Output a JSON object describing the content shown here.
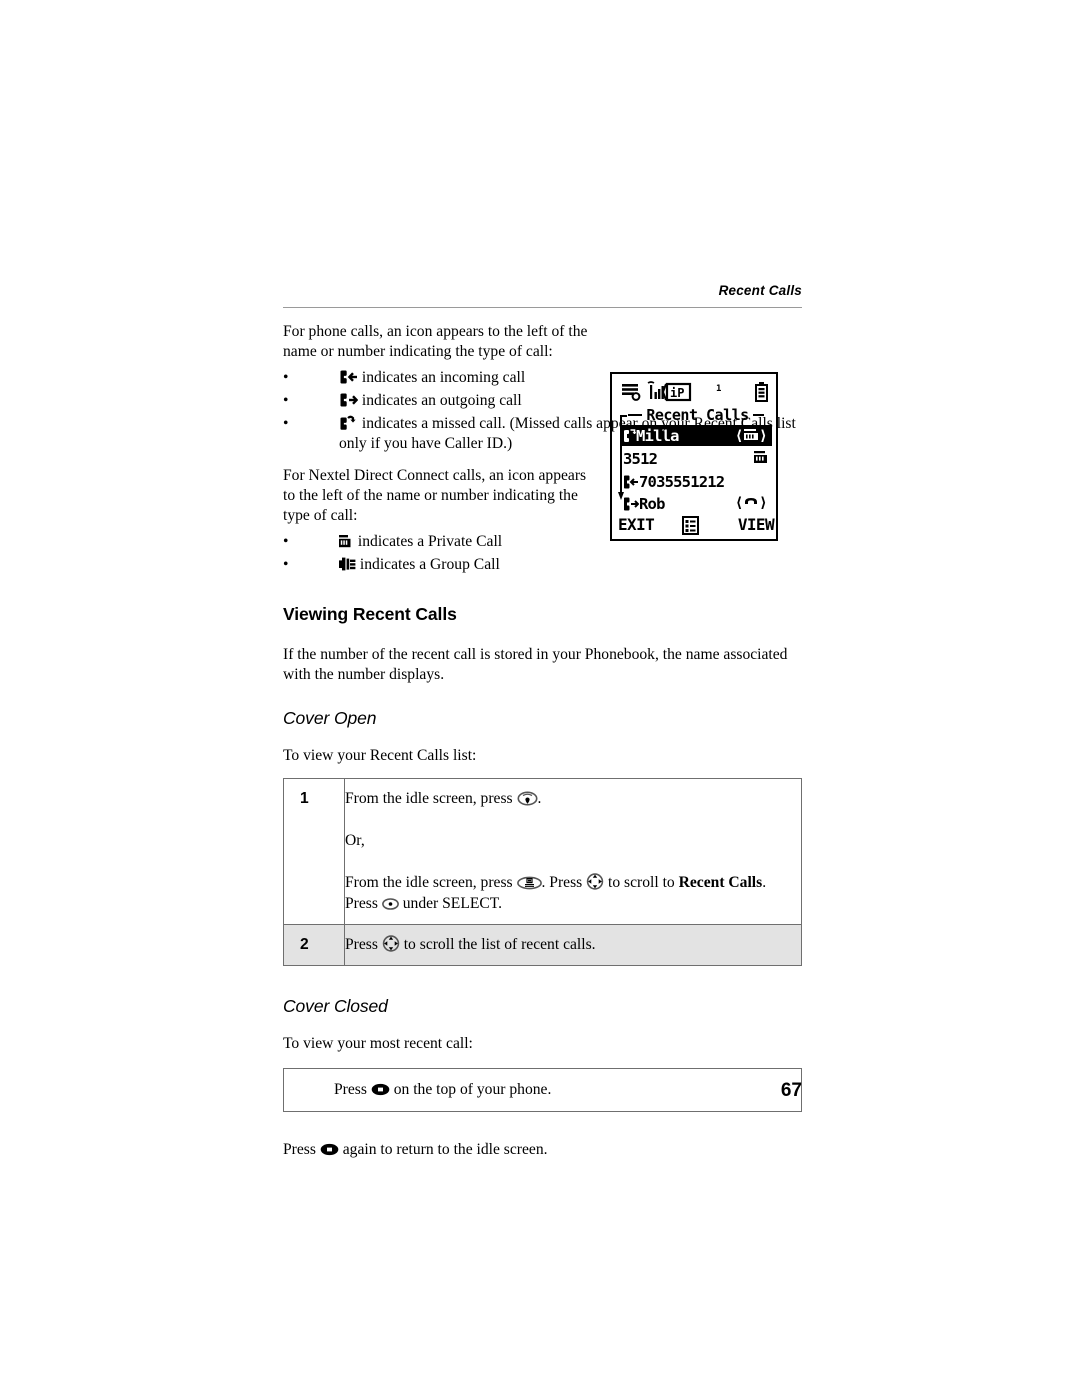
{
  "header": {
    "title": "Recent Calls"
  },
  "intro": {
    "phone_calls_text": "For phone calls, an icon appears to the left of the name or number indicating the type of call:",
    "bullets": [
      {
        "icon": "incoming-call-icon",
        "text": "indicates an incoming call"
      },
      {
        "icon": "outgoing-call-icon",
        "text": "indicates an outgoing call"
      },
      {
        "icon": "missed-call-icon",
        "text": "indicates a missed call. (Missed calls appear on your Recent Calls list only if you have Caller ID.)"
      }
    ],
    "direct_connect_text": "For Nextel Direct Connect calls, an icon appears to the left of the name or number indicating the type of call:",
    "dc_bullets": [
      {
        "icon": "private-call-icon",
        "text": "indicates a Private Call"
      },
      {
        "icon": "group-call-icon",
        "text": "indicates a Group Call"
      }
    ]
  },
  "phone_screen": {
    "title": "Recent Calls",
    "status_icons": [
      "messages-icon",
      "signal-strength-icon",
      "ip-icon",
      "battery-icon"
    ],
    "status_number": "1",
    "rows": [
      {
        "name": "Milla",
        "left_icon": "missed-call-icon",
        "right_icon": "private-call-icon",
        "selected": true
      },
      {
        "name": "3512",
        "left_icon": "",
        "right_icon": "private-call-icon",
        "selected": false
      },
      {
        "name": "7035551212",
        "left_icon": "incoming-call-icon",
        "right_icon": "",
        "selected": false
      },
      {
        "name": "Rob",
        "left_icon": "outgoing-call-icon",
        "right_icon": "phone-call-icon",
        "selected": false
      }
    ],
    "softkeys": {
      "left": "EXIT",
      "center": "menu-icon",
      "right": "VIEW"
    }
  },
  "section": {
    "heading": "Viewing Recent Calls",
    "intro": "If the number of the recent call is stored in your Phonebook, the name associated with the number displays."
  },
  "cover_open": {
    "heading": "Cover Open",
    "lead": "To view your Recent Calls list:",
    "steps": [
      {
        "num": "1",
        "line1_a": "From the idle screen, press ",
        "line1_b": ".",
        "line2": "Or,",
        "line3_a": "From the idle screen, press ",
        "line3_b": ". Press ",
        "line3_c": " to scroll to ",
        "line3_bold": "Recent Calls",
        "line3_d": ".",
        "line4_a": "Press ",
        "line4_b": " under SELECT.",
        "shaded": false
      },
      {
        "num": "2",
        "line1_a": "Press ",
        "line1_b": " to scroll the list of recent calls.",
        "shaded": true
      }
    ]
  },
  "cover_closed": {
    "heading": "Cover Closed",
    "lead": "To view your most recent call:",
    "step_a": "Press ",
    "step_b": " on the top of your phone.",
    "closing_a": "Press ",
    "closing_b": " again to return to the idle screen."
  },
  "footer": {
    "page_number": "67"
  },
  "colors": {
    "rule": "#9a9a9a",
    "table_border": "#6f6f6f",
    "shaded_row": "#e3e3e3",
    "text": "#000000"
  }
}
